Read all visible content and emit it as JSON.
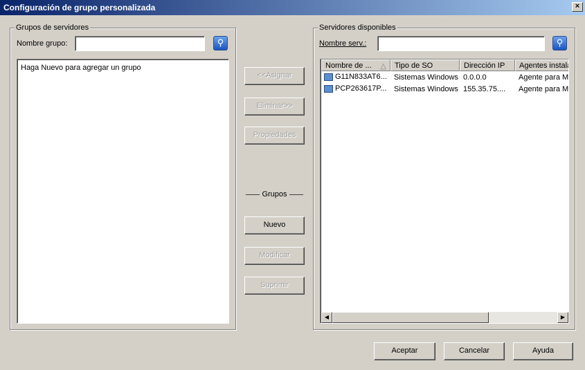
{
  "window": {
    "title": "Configuración de grupo personalizada",
    "close": "×"
  },
  "left": {
    "legend": "Grupos de servidores",
    "name_label": "Nombre grupo:",
    "name_value": "",
    "list_hint": "Haga Nuevo para agregar un grupo"
  },
  "middle": {
    "assign": "<<Asignar",
    "remove": "Eliminar>>",
    "properties": "Propiedades",
    "groups_label": "Grupos",
    "new": "Nuevo",
    "modify": "Modificar",
    "delete": "Suprimir"
  },
  "right": {
    "legend": "Servidores disponibles",
    "name_label": "Nombre serv.:",
    "name_value": "",
    "columns": [
      "Nombre de ...",
      "Tipo de SO",
      "Dirección IP",
      "Agentes instala"
    ],
    "rows": [
      {
        "name": "G11N833AT6...",
        "os": "Sistemas Windows",
        "ip": "0.0.0.0",
        "agents": "Agente para Mi"
      },
      {
        "name": "PCP263617P...",
        "os": "Sistemas Windows",
        "ip": "155.35.75....",
        "agents": "Agente para Mi"
      }
    ]
  },
  "footer": {
    "ok": "Aceptar",
    "cancel": "Cancelar",
    "help": "Ayuda"
  }
}
